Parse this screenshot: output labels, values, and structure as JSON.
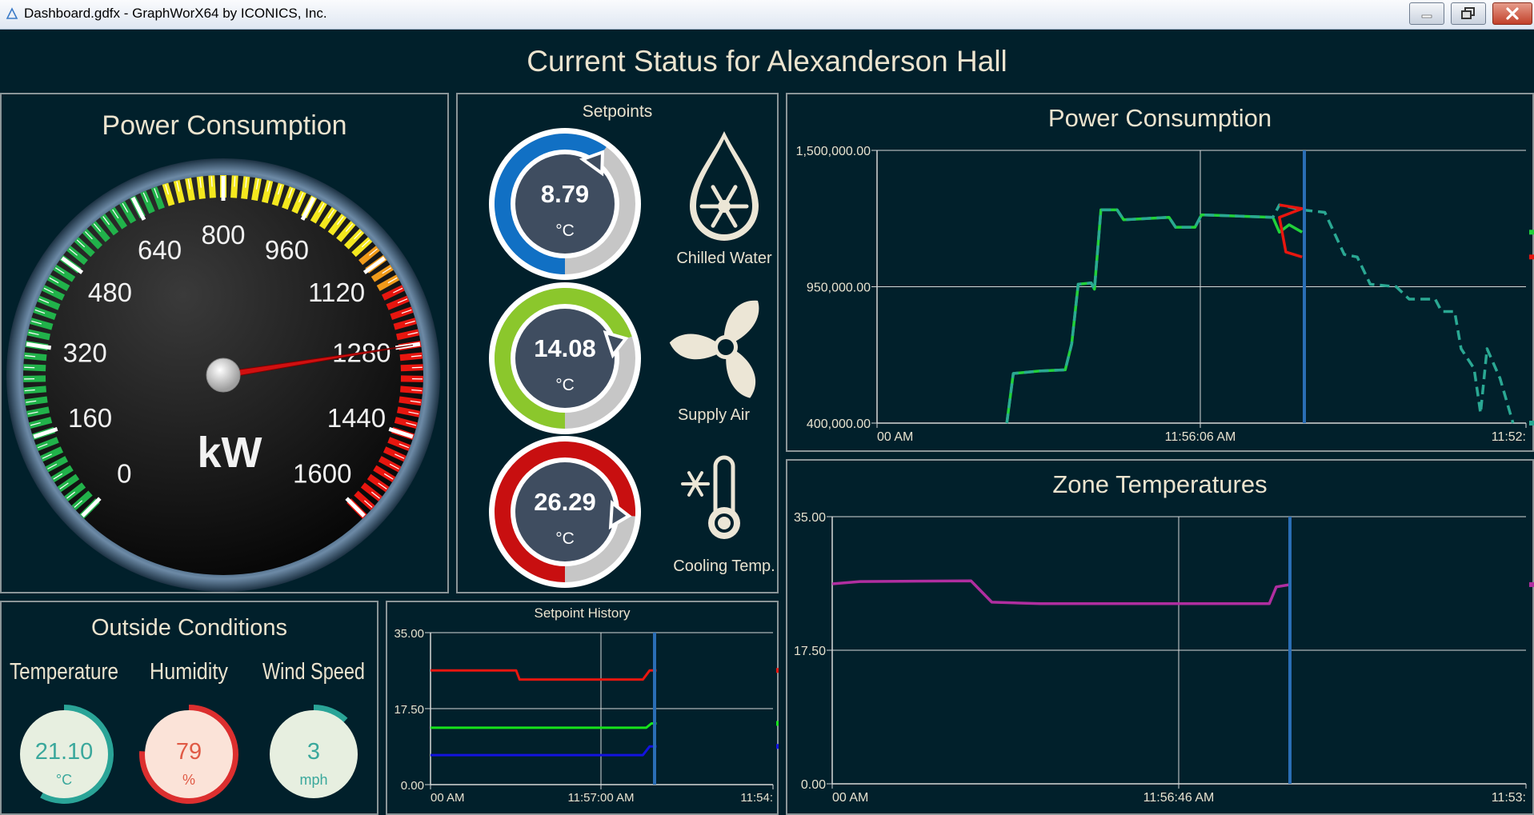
{
  "window": {
    "title": "Dashboard.gdfx - GraphWorX64 by ICONICS, Inc."
  },
  "dashboard": {
    "title": "Current Status for Alexanderson Hall"
  },
  "gauge": {
    "title": "Power Consumption",
    "unit": "kW",
    "min": 0,
    "max": 1600,
    "value": 1280,
    "scale_labels": [
      "0",
      "160",
      "320",
      "480",
      "640",
      "800",
      "960",
      "1120",
      "1280",
      "1440",
      "1600"
    ],
    "zone_colors": {
      "green": "#21b24a",
      "yellow": "#f4e81e",
      "red": "#e8160f"
    }
  },
  "setpoints": {
    "title": "Setpoints",
    "items": [
      {
        "value": "8.79",
        "unit": "°C",
        "label": "Chilled Water",
        "color": "#1170c4",
        "icon": "water-drop-snowflake-icon"
      },
      {
        "value": "14.08",
        "unit": "°C",
        "label": "Supply Air",
        "color": "#8bc72c",
        "icon": "fan-icon"
      },
      {
        "value": "26.29",
        "unit": "°C",
        "label": "Cooling Temp.",
        "color": "#c80f10",
        "icon": "thermometer-snowflake-icon"
      }
    ]
  },
  "outside": {
    "title": "Outside Conditions",
    "items": [
      {
        "label": "Temperature",
        "value": "21.10",
        "unit": "°C",
        "color": "#2aa497",
        "text_color": "#3aa89c"
      },
      {
        "label": "Humidity",
        "value": "79",
        "unit": "%",
        "color": "#dc2f2f",
        "text_color": "#e05a45"
      },
      {
        "label": "Wind Speed",
        "value": "3",
        "unit": "mph",
        "color": "#2aa497",
        "text_color": "#3aa89c"
      }
    ]
  },
  "power_chart": {
    "title": "Power Consumption",
    "y_ticks": [
      "1,500,000.00",
      "950,000.00",
      "400,000.00"
    ],
    "x_ticks": [
      "00 AM",
      "11:56:06 AM",
      "11:52:"
    ],
    "chart_data": {
      "type": "line",
      "ylim": [
        400000,
        1500000
      ],
      "series": [
        {
          "color": "#21d13a",
          "style": "solid",
          "values": [
            [
              0.2,
              400000
            ],
            [
              0.21,
              600000
            ],
            [
              0.25,
              610000
            ],
            [
              0.29,
              615000
            ],
            [
              0.3,
              720000
            ],
            [
              0.31,
              960000
            ],
            [
              0.33,
              965000
            ],
            [
              0.335,
              940000
            ],
            [
              0.345,
              1260000
            ],
            [
              0.37,
              1260000
            ],
            [
              0.38,
              1220000
            ],
            [
              0.45,
              1230000
            ],
            [
              0.46,
              1190000
            ],
            [
              0.49,
              1190000
            ],
            [
              0.5,
              1240000
            ],
            [
              0.61,
              1230000
            ],
            [
              0.62,
              1170000
            ],
            [
              0.635,
              1200000
            ],
            [
              0.655,
              1170000
            ]
          ]
        },
        {
          "color": "#2aa893",
          "style": "dashed",
          "values": [
            [
              0.2,
              400000
            ],
            [
              0.21,
              600000
            ],
            [
              0.25,
              610000
            ],
            [
              0.29,
              615000
            ],
            [
              0.3,
              720000
            ],
            [
              0.31,
              960000
            ],
            [
              0.33,
              965000
            ],
            [
              0.335,
              940000
            ],
            [
              0.345,
              1260000
            ],
            [
              0.37,
              1260000
            ],
            [
              0.38,
              1220000
            ],
            [
              0.45,
              1230000
            ],
            [
              0.46,
              1190000
            ],
            [
              0.49,
              1190000
            ],
            [
              0.5,
              1240000
            ],
            [
              0.61,
              1230000
            ],
            [
              0.62,
              1280000
            ],
            [
              0.655,
              1260000
            ],
            [
              0.69,
              1250000
            ],
            [
              0.72,
              1080000
            ],
            [
              0.74,
              1070000
            ],
            [
              0.76,
              960000
            ],
            [
              0.8,
              950000
            ],
            [
              0.82,
              900000
            ],
            [
              0.86,
              900000
            ],
            [
              0.87,
              850000
            ],
            [
              0.89,
              850000
            ],
            [
              0.9,
              700000
            ],
            [
              0.92,
              620000
            ],
            [
              0.93,
              440000
            ],
            [
              0.94,
              700000
            ],
            [
              0.96,
              580000
            ],
            [
              0.98,
              400000
            ]
          ]
        },
        {
          "color": "#e8160f",
          "style": "solid",
          "values": [
            [
              0.62,
              1280000
            ],
            [
              0.655,
              1265000
            ],
            [
              0.62,
              1230000
            ],
            [
              0.63,
              1090000
            ],
            [
              0.655,
              1070000
            ]
          ]
        }
      ]
    }
  },
  "zone_chart": {
    "title": "Zone Temperatures",
    "y_ticks": [
      "35.00",
      "17.50",
      "0.00"
    ],
    "x_ticks": [
      "00 AM",
      "11:56:46 AM",
      "11:53:"
    ],
    "chart_data": {
      "type": "line",
      "ylim": [
        0,
        35
      ],
      "series": [
        {
          "color": "#b02ea0",
          "values": [
            [
              0,
              26.2
            ],
            [
              0.04,
              26.5
            ],
            [
              0.2,
              26.6
            ],
            [
              0.23,
              23.8
            ],
            [
              0.3,
              23.6
            ],
            [
              0.63,
              23.6
            ],
            [
              0.64,
              25.8
            ],
            [
              0.66,
              26.1
            ]
          ]
        }
      ]
    }
  },
  "setpoint_history": {
    "title": "Setpoint History",
    "y_ticks": [
      "35.00",
      "17.50",
      "0.00"
    ],
    "x_ticks": [
      "00 AM",
      "11:57:00 AM",
      "11:54:"
    ],
    "chart_data": {
      "type": "line",
      "ylim": [
        0,
        35
      ],
      "series": [
        {
          "color": "#e8160f",
          "values": [
            [
              0,
              26.3
            ],
            [
              0.25,
              26.3
            ],
            [
              0.26,
              24.2
            ],
            [
              0.62,
              24.2
            ],
            [
              0.64,
              26.3
            ],
            [
              0.66,
              26.3
            ]
          ]
        },
        {
          "color": "#17e31b",
          "values": [
            [
              0,
              13.1
            ],
            [
              0.63,
              13.1
            ],
            [
              0.645,
              14.1
            ],
            [
              0.66,
              14.1
            ]
          ]
        },
        {
          "color": "#1313e0",
          "values": [
            [
              0,
              6.8
            ],
            [
              0.62,
              6.8
            ],
            [
              0.64,
              8.8
            ],
            [
              0.66,
              8.8
            ]
          ]
        }
      ]
    }
  }
}
